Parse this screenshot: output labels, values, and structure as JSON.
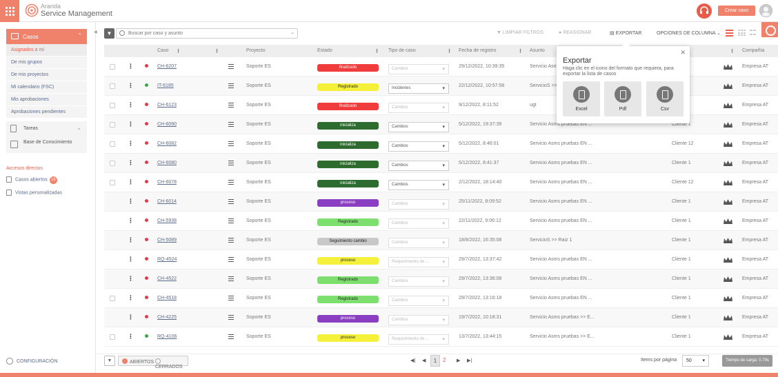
{
  "brand": {
    "line1": "Aranda",
    "line2": "Service Management"
  },
  "header": {
    "create_label": "Crear caso"
  },
  "sidebar": {
    "casos_label": "Casos",
    "items": [
      {
        "label": "Asignados a mí",
        "active": true
      },
      {
        "label": "De mis grupos",
        "active": false
      },
      {
        "label": "De mis proyectos",
        "active": false
      },
      {
        "label": "Mi calendario (FSC)",
        "active": false
      },
      {
        "label": "Mis aprobaciones",
        "active": false
      },
      {
        "label": "Aprobaciones pendientes",
        "active": false
      }
    ],
    "tareas_label": "Tareas",
    "base_label": "Base de Conocimiento",
    "accesos_title": "Accesos directos",
    "casos_abiertos": "Casos abiertos",
    "casos_abiertos_count": "18",
    "vistas": "Vistas personalizadas",
    "config": "CONFIGURACIÓN"
  },
  "toolbar": {
    "search_placeholder": "Buscar por caso y asunto",
    "limpiar": "LIMPIAR FILTROS",
    "reasignar": "REASIGNAR",
    "exportar": "EXPORTAR",
    "opciones": "OPCIONES DE COLUMNA"
  },
  "table": {
    "headers": {
      "caso": "Caso",
      "proyecto": "Proyecto",
      "estado": "Estado",
      "tipo": "Tipo de caso",
      "fecha": "Fecha de registro",
      "asunto": "Asunto",
      "compania": "Compañía"
    },
    "rows": [
      {
        "check": true,
        "dot": "red",
        "case": "CH-6207",
        "proj": "Soporte ES",
        "state": "finalizado",
        "sc": "#f03c3c",
        "tipo": "Cambios",
        "tipo_on": false,
        "fecha": "29/12/2022, 10:39:35",
        "asunto": "Servicio Asms",
        "cli": "",
        "comp": "Empresa AT"
      },
      {
        "check": true,
        "dot": "green",
        "case": "IT-6185",
        "proj": "Soporte ES",
        "state": "Registrado",
        "sc": "#f5f03a",
        "tipo": "Incidentes",
        "tipo_on": true,
        "fecha": "22/12/2022, 10:57:58",
        "asunto": "ServicioS >>",
        "cli": "",
        "comp": "Empresa AT"
      },
      {
        "check": true,
        "dot": "red",
        "case": "CH-6123",
        "proj": "Soporte ES",
        "state": "finalizado",
        "sc": "#f03c3c",
        "tipo": "Cambios",
        "tipo_on": false,
        "fecha": "9/12/2022, 8:11:52",
        "asunto": "ugt",
        "cli": "",
        "comp": "Empresa AT"
      },
      {
        "check": true,
        "dot": "red",
        "case": "CH-6090",
        "proj": "Soporte ES",
        "state": "inicializa",
        "sc": "#2e6b2e",
        "tipo": "Cambios",
        "tipo_on": true,
        "fecha": "5/12/2022, 19:37:39",
        "asunto": "Servicio Asms pruebas EN ...",
        "cli": "Cliente 1",
        "comp": "Empresa AT"
      },
      {
        "check": true,
        "dot": "red",
        "case": "CH-6082",
        "proj": "Soporte ES",
        "state": "inicializa",
        "sc": "#2e6b2e",
        "tipo": "Cambios",
        "tipo_on": true,
        "fecha": "5/12/2022, 8:46:01",
        "asunto": "Servicio Asms pruebas EN ...",
        "cli": "Cliente 12",
        "comp": "Empresa AT"
      },
      {
        "check": true,
        "dot": "red",
        "case": "CH-6080",
        "proj": "Soporte ES",
        "state": "inicializa",
        "sc": "#2e6b2e",
        "tipo": "Cambios",
        "tipo_on": true,
        "fecha": "5/12/2022, 8:41:37",
        "asunto": "Servicio Asms pruebas EN ...",
        "cli": "Cliente 1",
        "comp": "Empresa AT"
      },
      {
        "check": true,
        "dot": "red",
        "case": "CH-6078",
        "proj": "Soporte ES",
        "state": "inicializa",
        "sc": "#2e6b2e",
        "tipo": "Cambios",
        "tipo_on": true,
        "fecha": "2/12/2022, 18:14:40",
        "asunto": "Servicio Asms pruebas EN ...",
        "cli": "Cliente 12",
        "comp": "Empresa AT"
      },
      {
        "check": false,
        "dot": "red",
        "case": "CH-6014",
        "proj": "Soporte ES",
        "state": "proceso",
        "sc": "#8a3fc2",
        "tipo": "Cambios",
        "tipo_on": false,
        "fecha": "25/11/2022, 8:09:52",
        "asunto": "Servicio Asms pruebas EN ...",
        "cli": "Cliente 1",
        "comp": "Empresa AT"
      },
      {
        "check": false,
        "dot": "red",
        "case": "CH-5938",
        "proj": "Soporte ES",
        "state": "Registrado",
        "sc": "#7de06e",
        "tipo": "Cambios",
        "tipo_on": false,
        "fecha": "22/11/2022, 9:06:12",
        "asunto": "Servicio Asms pruebas EN ...",
        "cli": "Cliente 1",
        "comp": "Empresa AT"
      },
      {
        "check": false,
        "dot": "red",
        "case": "CH-5089",
        "proj": "Soporte ES",
        "state": "Seguimiento cambio",
        "sc": "#c8c8c8",
        "tipo": "Cambios",
        "tipo_on": false,
        "fecha": "18/8/2022, 16:35:08",
        "asunto": "ServicioS >> Raiz 1",
        "cli": "Cliente 1",
        "comp": "Empresa AT"
      },
      {
        "check": false,
        "dot": "red",
        "case": "RQ-4524",
        "proj": "Soporte ES",
        "state": "proceso",
        "sc": "#f5f03a",
        "tipo": "Requerimiento de ...",
        "tipo_on": false,
        "fecha": "29/7/2022, 13:37:42",
        "asunto": "Servicio Asms pruebas EN ...",
        "cli": "Cliente 1",
        "comp": "Empresa AT"
      },
      {
        "check": false,
        "dot": "red",
        "case": "CH-4522",
        "proj": "Soporte ES",
        "state": "Registrado",
        "sc": "#7de06e",
        "tipo": "Cambios",
        "tipo_on": false,
        "fecha": "29/7/2022, 13:36:08",
        "asunto": "Servicio Asms pruebas EN ...",
        "cli": "Cliente 1",
        "comp": "Empresa AT"
      },
      {
        "check": true,
        "dot": "red",
        "case": "CH-4518",
        "proj": "Soporte ES",
        "state": "Registrado",
        "sc": "#7de06e",
        "tipo": "Cambios",
        "tipo_on": false,
        "fecha": "29/7/2022, 13:16:18",
        "asunto": "Servicio Asms pruebas EN ...",
        "cli": "Cliente 1",
        "comp": "Empresa AT"
      },
      {
        "check": false,
        "dot": "red",
        "case": "CH-4225",
        "proj": "Soporte ES",
        "state": "proceso",
        "sc": "#8a3fc2",
        "tipo": "Cambios",
        "tipo_on": false,
        "fecha": "19/7/2022, 10:18:31",
        "asunto": "Servicio Asms pruebas >> E...",
        "cli": "Cliente 1",
        "comp": "Empresa AT"
      },
      {
        "check": true,
        "dot": "green",
        "case": "RQ-4106",
        "proj": "Soporte ES",
        "state": "proceso",
        "sc": "#f5f03a",
        "tipo": "Requerimiento de ...",
        "tipo_on": false,
        "fecha": "13/7/2022, 13:44:15",
        "asunto": "Servicio Asms pruebas >> E...",
        "cli": "Cliente 1",
        "comp": "Empresa AT"
      }
    ]
  },
  "export": {
    "title": "Exportar",
    "desc": "Haga clic en el icono del formato que requiera, para exportar la lista de casos",
    "formats": [
      "Excel",
      "Pdf",
      "Csv"
    ]
  },
  "footer": {
    "abiertos": "ABIERTOS",
    "cerrados": "CERRADOS",
    "page1": "1",
    "page2": "2",
    "items_label": "Items por página",
    "items_value": "50",
    "load_time": "Tiempo de carga: 0.79s"
  },
  "colors": {
    "accent": "#f0826c",
    "accent_dark": "#e85d4a",
    "link": "#5a6a8a"
  }
}
